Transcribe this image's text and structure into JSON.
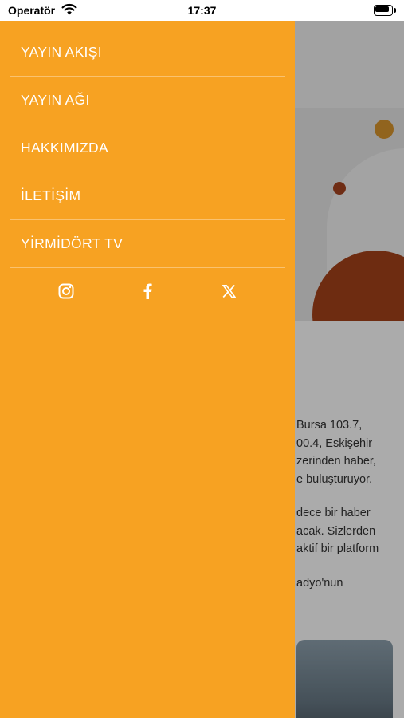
{
  "status_bar": {
    "carrier": "Operatör",
    "time": "17:37"
  },
  "drawer": {
    "background_color": "#f7a222",
    "menu_items": [
      {
        "label": "YAYIN AKIŞI"
      },
      {
        "label": "YAYIN AĞI"
      },
      {
        "label": "HAKKIMIZDA"
      },
      {
        "label": "İLETİŞİM"
      },
      {
        "label": "YİRMİDÖRT TV"
      }
    ],
    "social_icons": [
      "instagram-icon",
      "facebook-icon",
      "x-icon"
    ]
  },
  "background_page": {
    "paragraph_lines": [
      [
        "Bursa 103.7,",
        "00.4, Eskişehir",
        "zerinden haber,",
        "e buluşturuyor."
      ],
      [
        "dece bir haber",
        "acak. Sizlerden",
        "aktif bir platform"
      ],
      [
        "adyo'nun"
      ]
    ],
    "accent_colors": {
      "orange_dot": "#d9962d",
      "rust": "#a5421a"
    }
  }
}
